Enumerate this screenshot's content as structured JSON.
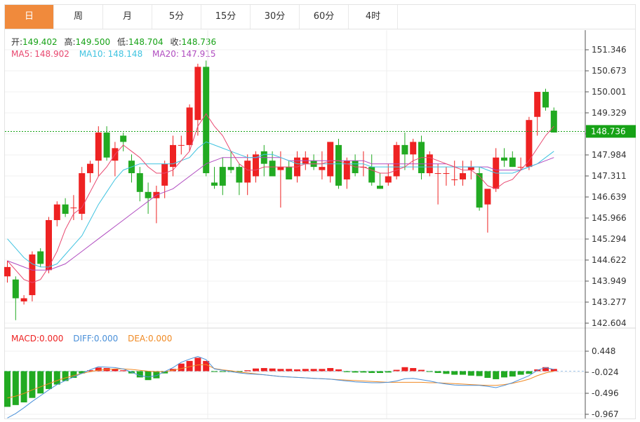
{
  "tabs": [
    {
      "label": "日",
      "active": true
    },
    {
      "label": "周",
      "active": false
    },
    {
      "label": "月",
      "active": false
    },
    {
      "label": "5分",
      "active": false
    },
    {
      "label": "15分",
      "active": false
    },
    {
      "label": "30分",
      "active": false
    },
    {
      "label": "60分",
      "active": false
    },
    {
      "label": "4时",
      "active": false
    }
  ],
  "ohlc_info": {
    "open_label": "开:",
    "open": "149.402",
    "high_label": "高:",
    "high": "149.500",
    "low_label": "低:",
    "low": "148.704",
    "close_label": "收:",
    "close": "148.736"
  },
  "ma_info": {
    "ma5_label": "MA5:",
    "ma5": "148.902",
    "ma10_label": "MA10:",
    "ma10": "148.148",
    "ma20_label": "MA20:",
    "ma20": "147.915"
  },
  "macd_info": {
    "macd_label": "MACD:",
    "macd": "0.000",
    "diff_label": "DIFF:",
    "diff": "0.000",
    "dea_label": "DEA:",
    "dea": "0.000"
  },
  "colors": {
    "up": "#ee2222",
    "down": "#22aa22",
    "ma5": "#e8476f",
    "ma10": "#3fc3e0",
    "ma20": "#b04cc0",
    "diff": "#4a90d9",
    "dea": "#f08a24",
    "tab_active": "#f08a3c",
    "last_price_bg": "#16a216"
  },
  "chart_data": {
    "type": "candlestick",
    "price_ticks": [
      "151.346",
      "150.673",
      "150.001",
      "149.329",
      "148.656",
      "147.984",
      "147.311",
      "146.639",
      "145.966",
      "145.294",
      "144.622",
      "143.949",
      "143.277",
      "142.604"
    ],
    "price_ylim": [
      142.604,
      151.346
    ],
    "last_price": 148.736,
    "last_price_label": "148.736",
    "macd_ticks": [
      "0.448",
      "-0.024",
      "-0.496",
      "-0.967"
    ],
    "macd_ylim": [
      -0.967,
      0.448
    ],
    "candles": [
      [
        144.1,
        144.6,
        143.9,
        144.4
      ],
      [
        144.0,
        144.1,
        142.7,
        143.4
      ],
      [
        143.3,
        143.5,
        143.2,
        143.4
      ],
      [
        143.5,
        144.9,
        143.3,
        144.8
      ],
      [
        144.9,
        145.0,
        144.4,
        144.5
      ],
      [
        144.3,
        146.0,
        144.2,
        145.9
      ],
      [
        145.9,
        146.5,
        145.7,
        146.4
      ],
      [
        146.4,
        146.6,
        146.0,
        146.1
      ],
      [
        146.3,
        146.7,
        145.9,
        146.3
      ],
      [
        146.1,
        147.6,
        145.9,
        147.4
      ],
      [
        147.4,
        147.8,
        147.1,
        147.7
      ],
      [
        147.8,
        148.9,
        147.3,
        148.7
      ],
      [
        148.7,
        148.9,
        147.8,
        147.9
      ],
      [
        147.8,
        148.4,
        147.3,
        148.2
      ],
      [
        148.6,
        148.7,
        148.1,
        148.4
      ],
      [
        147.8,
        148.0,
        147.1,
        147.4
      ],
      [
        147.4,
        147.6,
        146.5,
        146.8
      ],
      [
        146.8,
        147.1,
        146.1,
        146.6
      ],
      [
        146.6,
        147.0,
        145.8,
        146.8
      ],
      [
        147.0,
        147.8,
        146.6,
        147.7
      ],
      [
        147.6,
        148.6,
        147.3,
        148.3
      ],
      [
        148.3,
        148.6,
        148.0,
        148.3
      ],
      [
        148.3,
        149.6,
        148.1,
        149.5
      ],
      [
        149.1,
        150.9,
        148.6,
        150.8
      ],
      [
        150.8,
        151.0,
        147.3,
        147.4
      ],
      [
        147.1,
        147.6,
        146.9,
        147.0
      ],
      [
        147.6,
        147.9,
        146.7,
        147.0
      ],
      [
        147.6,
        148.1,
        147.4,
        147.5
      ],
      [
        147.6,
        147.7,
        146.7,
        147.1
      ],
      [
        147.1,
        148.0,
        146.7,
        147.8
      ],
      [
        147.3,
        148.1,
        147.1,
        148.0
      ],
      [
        148.1,
        148.3,
        147.3,
        147.7
      ],
      [
        147.8,
        148.1,
        147.3,
        147.3
      ],
      [
        147.5,
        148.1,
        146.3,
        147.6
      ],
      [
        147.6,
        147.8,
        147.2,
        147.2
      ],
      [
        147.3,
        148.1,
        147.1,
        147.9
      ],
      [
        147.7,
        148.1,
        147.5,
        147.9
      ],
      [
        147.8,
        148.0,
        147.5,
        147.6
      ],
      [
        147.5,
        148.1,
        147.2,
        147.6
      ],
      [
        147.3,
        148.4,
        147.1,
        148.4
      ],
      [
        148.3,
        148.5,
        146.9,
        147.0
      ],
      [
        147.2,
        147.9,
        146.9,
        147.8
      ],
      [
        147.8,
        148.0,
        147.3,
        147.4
      ],
      [
        147.6,
        148.1,
        147.3,
        147.6
      ],
      [
        147.6,
        148.0,
        147.0,
        147.1
      ],
      [
        147.0,
        147.4,
        146.9,
        146.9
      ],
      [
        147.1,
        147.7,
        147.0,
        147.3
      ],
      [
        147.3,
        148.4,
        147.2,
        148.3
      ],
      [
        148.3,
        148.7,
        147.5,
        148.0
      ],
      [
        148.0,
        148.5,
        147.5,
        148.4
      ],
      [
        148.4,
        148.6,
        147.2,
        147.4
      ],
      [
        147.4,
        148.1,
        147.3,
        148.0
      ],
      [
        147.4,
        147.7,
        146.4,
        147.4
      ],
      [
        147.4,
        147.6,
        147.0,
        147.4
      ],
      [
        147.2,
        147.8,
        147.0,
        147.2
      ],
      [
        147.2,
        147.8,
        147.0,
        147.4
      ],
      [
        147.5,
        147.8,
        147.2,
        147.6
      ],
      [
        147.4,
        147.6,
        146.2,
        146.3
      ],
      [
        146.4,
        146.7,
        145.5,
        146.9
      ],
      [
        146.9,
        148.2,
        146.8,
        147.9
      ],
      [
        147.9,
        148.2,
        147.6,
        147.8
      ],
      [
        147.9,
        148.1,
        147.6,
        147.6
      ],
      [
        147.6,
        147.9,
        147.5,
        147.6
      ],
      [
        147.6,
        149.2,
        147.5,
        149.1
      ],
      [
        149.2,
        150.0,
        148.6,
        150.0
      ],
      [
        150.0,
        150.1,
        149.4,
        149.5
      ],
      [
        149.4,
        149.5,
        148.7,
        148.7
      ]
    ],
    "ma5": [
      144.6,
      144.3,
      144.0,
      143.9,
      144.0,
      144.4,
      144.9,
      145.6,
      146.1,
      146.3,
      146.8,
      147.3,
      147.6,
      148.0,
      148.3,
      148.1,
      147.9,
      147.6,
      147.4,
      147.4,
      147.5,
      147.8,
      148.1,
      148.9,
      149.3,
      148.9,
      148.6,
      148.1,
      147.7,
      147.5,
      147.5,
      147.6,
      147.6,
      147.6,
      147.6,
      147.6,
      147.7,
      147.7,
      147.7,
      147.8,
      147.8,
      147.7,
      147.6,
      147.6,
      147.5,
      147.4,
      147.4,
      147.5,
      147.6,
      147.8,
      147.9,
      147.9,
      147.8,
      147.7,
      147.6,
      147.5,
      147.5,
      147.3,
      147.0,
      146.9,
      147.1,
      147.2,
      147.5,
      147.8,
      148.2,
      148.6,
      148.9
    ],
    "ma10": [
      145.3,
      145.0,
      144.7,
      144.5,
      144.4,
      144.4,
      144.5,
      144.8,
      145.1,
      145.4,
      145.9,
      146.4,
      146.8,
      147.2,
      147.5,
      147.6,
      147.7,
      147.7,
      147.7,
      147.7,
      147.7,
      147.8,
      147.9,
      148.2,
      148.4,
      148.3,
      148.2,
      148.1,
      148.0,
      147.9,
      147.9,
      148.0,
      148.0,
      147.9,
      147.8,
      147.7,
      147.7,
      147.7,
      147.7,
      147.7,
      147.7,
      147.7,
      147.7,
      147.7,
      147.6,
      147.6,
      147.6,
      147.6,
      147.6,
      147.6,
      147.6,
      147.6,
      147.6,
      147.6,
      147.6,
      147.6,
      147.6,
      147.6,
      147.5,
      147.4,
      147.4,
      147.4,
      147.5,
      147.6,
      147.7,
      147.9,
      148.1
    ],
    "ma20": [
      144.6,
      144.5,
      144.4,
      144.3,
      144.3,
      144.3,
      144.4,
      144.5,
      144.7,
      144.9,
      145.1,
      145.3,
      145.5,
      145.7,
      145.9,
      146.1,
      146.3,
      146.5,
      146.7,
      146.8,
      146.9,
      147.1,
      147.3,
      147.5,
      147.7,
      147.8,
      147.9,
      147.9,
      147.9,
      147.9,
      147.9,
      147.9,
      147.9,
      147.9,
      147.8,
      147.8,
      147.8,
      147.8,
      147.8,
      147.8,
      147.8,
      147.8,
      147.8,
      147.8,
      147.7,
      147.7,
      147.7,
      147.7,
      147.7,
      147.7,
      147.7,
      147.7,
      147.7,
      147.7,
      147.6,
      147.6,
      147.6,
      147.6,
      147.6,
      147.5,
      147.5,
      147.5,
      147.5,
      147.6,
      147.7,
      147.8,
      147.9
    ],
    "macd_hist": [
      -0.8,
      -0.76,
      -0.7,
      -0.6,
      -0.5,
      -0.4,
      -0.3,
      -0.22,
      -0.15,
      -0.05,
      0.02,
      0.08,
      0.07,
      0.05,
      0.02,
      -0.05,
      -0.14,
      -0.2,
      -0.16,
      -0.05,
      0.05,
      0.17,
      0.23,
      0.3,
      0.23,
      -0.01,
      -0.01,
      -0.01,
      -0.01,
      0.02,
      0.06,
      0.07,
      0.06,
      0.05,
      0.05,
      0.04,
      0.05,
      0.05,
      0.05,
      0.07,
      0.04,
      -0.02,
      -0.03,
      -0.03,
      -0.04,
      -0.04,
      -0.03,
      0.03,
      0.09,
      0.07,
      0.03,
      -0.01,
      -0.04,
      -0.06,
      -0.08,
      -0.08,
      -0.1,
      -0.11,
      -0.15,
      -0.18,
      -0.14,
      -0.12,
      -0.08,
      -0.06,
      0.04,
      0.09,
      0.05
    ],
    "macd_diff": [
      -1.05,
      -0.95,
      -0.82,
      -0.68,
      -0.55,
      -0.42,
      -0.3,
      -0.21,
      -0.13,
      -0.05,
      0.03,
      0.1,
      0.09,
      0.08,
      0.05,
      -0.02,
      -0.1,
      -0.13,
      -0.1,
      -0.01,
      0.08,
      0.2,
      0.27,
      0.33,
      0.26,
      0.05,
      0.02,
      -0.01,
      -0.04,
      -0.06,
      -0.07,
      -0.08,
      -0.1,
      -0.12,
      -0.13,
      -0.14,
      -0.15,
      -0.16,
      -0.17,
      -0.18,
      -0.2,
      -0.22,
      -0.24,
      -0.25,
      -0.26,
      -0.26,
      -0.25,
      -0.22,
      -0.17,
      -0.16,
      -0.19,
      -0.22,
      -0.26,
      -0.29,
      -0.31,
      -0.32,
      -0.32,
      -0.32,
      -0.34,
      -0.37,
      -0.32,
      -0.26,
      -0.18,
      -0.1,
      0.02,
      0.08,
      0.04
    ],
    "macd_dea": [
      -0.6,
      -0.56,
      -0.5,
      -0.42,
      -0.35,
      -0.28,
      -0.21,
      -0.15,
      -0.1,
      -0.05,
      -0.01,
      0.02,
      0.04,
      0.05,
      0.05,
      0.04,
      0.02,
      0.0,
      -0.01,
      -0.01,
      0.02,
      0.06,
      0.1,
      0.14,
      0.15,
      0.06,
      0.03,
      0.01,
      -0.02,
      -0.04,
      -0.06,
      -0.08,
      -0.1,
      -0.12,
      -0.13,
      -0.14,
      -0.15,
      -0.16,
      -0.17,
      -0.18,
      -0.19,
      -0.2,
      -0.21,
      -0.22,
      -0.23,
      -0.24,
      -0.25,
      -0.25,
      -0.25,
      -0.25,
      -0.25,
      -0.26,
      -0.26,
      -0.27,
      -0.28,
      -0.29,
      -0.3,
      -0.31,
      -0.32,
      -0.32,
      -0.3,
      -0.27,
      -0.23,
      -0.18,
      -0.1,
      -0.04,
      0.0
    ]
  }
}
